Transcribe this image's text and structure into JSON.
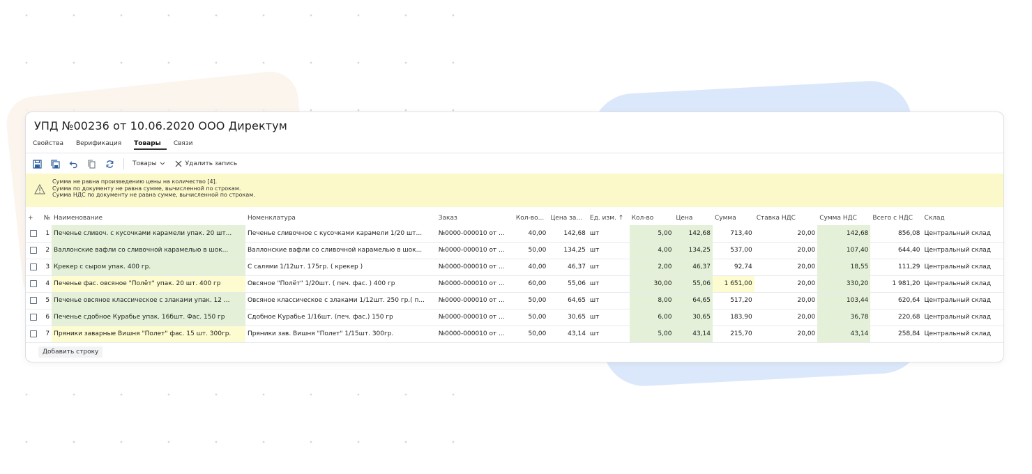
{
  "window": {
    "title": "УПД №00236 от 10.06.2020 ООО Директум"
  },
  "tabs": [
    {
      "label": "Свойства"
    },
    {
      "label": "Верификация"
    },
    {
      "label": "Товары"
    },
    {
      "label": "Связи"
    }
  ],
  "toolbar": {
    "goods_label": "Товары",
    "delete_label": "Удалить запись",
    "icons": [
      "save-icon",
      "save-all-icon",
      "undo-icon",
      "copy-icon",
      "refresh-icon",
      "chevron-down-icon",
      "close-icon"
    ]
  },
  "warnings": [
    "Сумма не равна произведению цены на количество [4].",
    "Сумма по документу не равна сумме, вычисленной по строкам.",
    "Сумма НДС по документу не равна сумме, вычисленной по строкам."
  ],
  "table": {
    "headers": {
      "add": "+",
      "no": "№",
      "name": "Наименование",
      "nomenclature": "Номенклатура",
      "order": "Заказ",
      "qty_order": "Кол-во...",
      "price_order": "Цена за...",
      "unit": "Ед. изм. ↑",
      "qty": "Кол-во",
      "price": "Цена",
      "sum": "Сумма",
      "vat_rate": "Ставка НДС",
      "vat_sum": "Сумма НДС",
      "total": "Всего с НДС",
      "warehouse": "Склад"
    },
    "rows": [
      {
        "no": "1",
        "name": "Печенье сливоч. с кусочками карамели упак. 20 шт...",
        "nomenclature": "Печенье сливочное с кусочками карамели 1/20 шт...",
        "order": "№0000-000010 от ...",
        "qty_order": "40,00",
        "price_order": "142,68",
        "unit": "шт",
        "qty": "5,00",
        "price": "142,68",
        "sum": "713,40",
        "vat_rate": "20,00",
        "vat_sum": "142,68",
        "total": "856,08",
        "warehouse": "Центральный склад"
      },
      {
        "no": "2",
        "name": "Валлонские вафли со сливочной карамелью в шок...",
        "nomenclature": "Валлонские вафли со сливочной карамелью в шок...",
        "order": "№0000-000010 от ...",
        "qty_order": "50,00",
        "price_order": "134,25",
        "unit": "шт",
        "qty": "4,00",
        "price": "134,25",
        "sum": "537,00",
        "vat_rate": "20,00",
        "vat_sum": "107,40",
        "total": "644,40",
        "warehouse": "Центральный склад"
      },
      {
        "no": "3",
        "name": "Крекер с сыром упак. 400 гр.",
        "nomenclature": "С салями 1/12шт. 175гр. ( крекер )",
        "order": "№0000-000010 от ...",
        "qty_order": "40,00",
        "price_order": "46,37",
        "unit": "шт",
        "qty": "2,00",
        "price": "46,37",
        "sum": "92,74",
        "vat_rate": "20,00",
        "vat_sum": "18,55",
        "total": "111,29",
        "warehouse": "Центральный склад"
      },
      {
        "no": "4",
        "name": "Печенье фас. овсяное \"Полёт\" упак. 20 шт. 400 гр",
        "nomenclature": "Овсяное \"Полёт\" 1/20шт. ( печ. фас. ) 400 гр",
        "order": "№0000-000010 от ...",
        "qty_order": "60,00",
        "price_order": "55,06",
        "unit": "шт",
        "qty": "30,00",
        "price": "55,06",
        "sum": "1 651,00",
        "vat_rate": "20,00",
        "vat_sum": "330,20",
        "total": "1 981,20",
        "warehouse": "Центральный склад"
      },
      {
        "no": "5",
        "name": "Печенье овсяное классическое с злаками упак. 12 ...",
        "nomenclature": "Овсяное классическое с злаками 1/12шт. 250 гр.( п...",
        "order": "№0000-000010 от ...",
        "qty_order": "50,00",
        "price_order": "64,65",
        "unit": "шт",
        "qty": "8,00",
        "price": "64,65",
        "sum": "517,20",
        "vat_rate": "20,00",
        "vat_sum": "103,44",
        "total": "620,64",
        "warehouse": "Центральный склад"
      },
      {
        "no": "6",
        "name": "Печенье сдобное Курабье упак. 16бшт. Фас. 150 гр",
        "nomenclature": "Сдобное Курабье 1/16шт. (печ. фас.) 150 гр",
        "order": "№0000-000010 от ...",
        "qty_order": "50,00",
        "price_order": "30,65",
        "unit": "шт",
        "qty": "6,00",
        "price": "30,65",
        "sum": "183,90",
        "vat_rate": "20,00",
        "vat_sum": "36,78",
        "total": "220,68",
        "warehouse": "Центральный склад"
      },
      {
        "no": "7",
        "name": "Пряники заварные Вишня \"Полет\" фас. 15 шт. 300гр.",
        "nomenclature": "Пряники зав. Вишня \"Полет\" 1/15шт. 300гр.",
        "order": "№0000-000010 от ...",
        "qty_order": "50,00",
        "price_order": "43,14",
        "unit": "шт",
        "qty": "5,00",
        "price": "43,14",
        "sum": "215,70",
        "vat_rate": "20,00",
        "vat_sum": "43,14",
        "total": "258,84",
        "warehouse": "Центральный склад"
      }
    ],
    "highlights": {
      "name_rows_yellow": [
        4,
        7
      ],
      "sum_rows_yellow": [
        4
      ]
    }
  },
  "add_row_label": "Добавить строку",
  "colors": {
    "ok_green": "#e4f1d8",
    "warn_yellow": "#fdfbd0",
    "warning_bar": "#fbf9c9",
    "accent_blue": "#3b6fb6"
  }
}
